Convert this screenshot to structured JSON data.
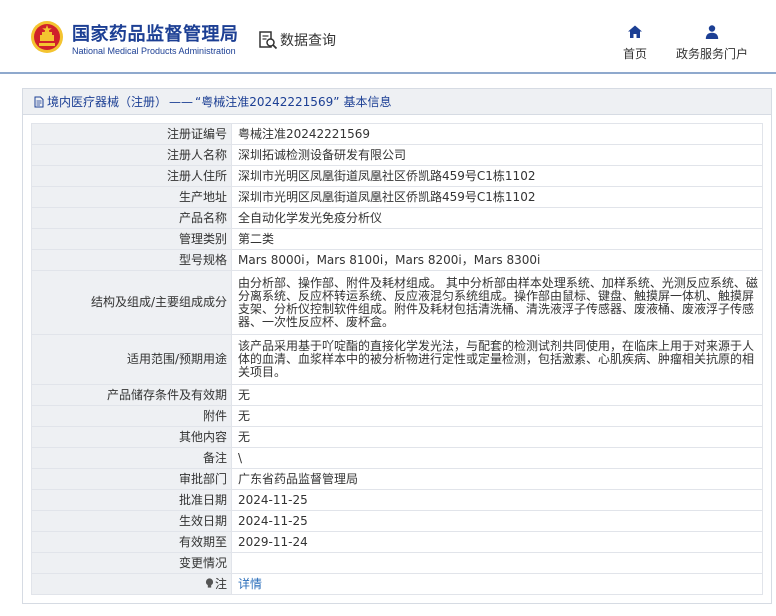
{
  "header": {
    "org_name_cn": "国家药品监督管理局",
    "org_name_en": "National Medical Products Administration",
    "data_query_label": "数据查询",
    "nav_home_label": "首页",
    "nav_portal_label": "政务服务门户"
  },
  "panel": {
    "breadcrumb_category": "境内医疗器械（注册）",
    "breadcrumb_separator": "——",
    "breadcrumb_record": "“粤械注准20242221569”",
    "breadcrumb_suffix": "基本信息"
  },
  "rows": [
    {
      "label": "注册证编号",
      "value": "粤械注准20242221569"
    },
    {
      "label": "注册人名称",
      "value": "深圳拓诚检测设备研发有限公司"
    },
    {
      "label": "注册人住所",
      "value": "深圳市光明区凤凰街道凤凰社区侨凯路459号C1栋1102"
    },
    {
      "label": "生产地址",
      "value": "深圳市光明区凤凰街道凤凰社区侨凯路459号C1栋1102"
    },
    {
      "label": "产品名称",
      "value": "全自动化学发光免疫分析仪"
    },
    {
      "label": "管理类别",
      "value": "第二类"
    },
    {
      "label": "型号规格",
      "value": "Mars 8000i，Mars 8100i，Mars 8200i，Mars 8300i"
    },
    {
      "label": "结构及组成/主要组成成分",
      "value": "由分析部、操作部、附件及耗材组成。 其中分析部由样本处理系统、加样系统、光测反应系统、磁分离系统、反应杯转运系统、反应液混匀系统组成。操作部由鼠标、键盘、触摸屏一体机、触摸屏支架、分析仪控制软件组成。附件及耗材包括清洗桶、清洗液浮子传感器、废液桶、废液浮子传感器、一次性反应杯、废杯盒。"
    },
    {
      "label": "适用范围/预期用途",
      "value": "该产品采用基于吖啶酯的直接化学发光法，与配套的检测试剂共同使用，在临床上用于对来源于人体的血清、血浆样本中的被分析物进行定性或定量检测，包括激素、心肌疾病、肿瘤相关抗原的相关项目。"
    },
    {
      "label": "产品储存条件及有效期",
      "value": "无"
    },
    {
      "label": "附件",
      "value": "无"
    },
    {
      "label": "其他内容",
      "value": "无"
    },
    {
      "label": "备注",
      "value": "\\"
    },
    {
      "label": "审批部门",
      "value": "广东省药品监督管理局"
    },
    {
      "label": "批准日期",
      "value": "2024-11-25"
    },
    {
      "label": "生效日期",
      "value": "2024-11-25"
    },
    {
      "label": "有效期至",
      "value": "2029-11-24"
    },
    {
      "label": "变更情况",
      "value": ""
    },
    {
      "label": "注",
      "value": "详情"
    }
  ],
  "colors": {
    "brand_blue": "#1c3f94",
    "link_blue": "#2a6ebb",
    "label_cell_bg": "#eef0f3",
    "emblem_red": "#d0212a",
    "emblem_gold": "#f4c430"
  },
  "icons": {
    "emblem": "national-emblem-icon",
    "data_query": "search-document-icon",
    "home": "home-icon",
    "portal": "user-icon",
    "breadcrumb": "document-icon",
    "note": "lightbulb-icon"
  }
}
